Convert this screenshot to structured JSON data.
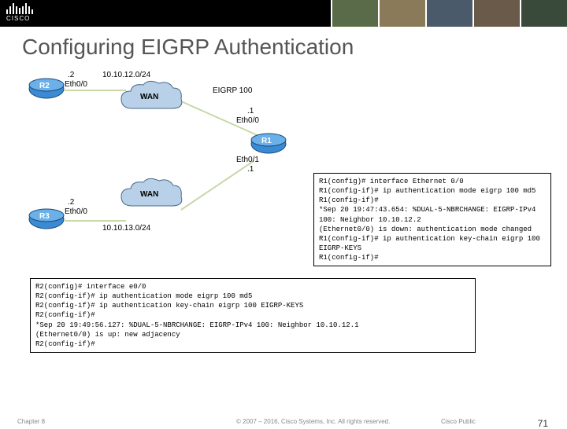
{
  "banner": {
    "brand": "CISCO"
  },
  "title": "Configuring EIGRP Authentication",
  "diagram": {
    "routers": {
      "r1": {
        "name": "R1"
      },
      "r2": {
        "name": "R2"
      },
      "r3": {
        "name": "R3"
      }
    },
    "clouds": {
      "wan1": "WAN",
      "wan2": "WAN"
    },
    "labels": {
      "eigrp": "EIGRP 100",
      "net_top": "10.10.12.0/24",
      "net_bot": "10.10.13.0/24",
      "r2_ip": ".2",
      "r2_if": "Eth0/0",
      "r3_ip": ".2",
      "r3_if": "Eth0/0",
      "r1_top_ip": ".1",
      "r1_top_if": "Eth0/0",
      "r1_bot_ip": ".1",
      "r1_bot_if": "Eth0/1"
    }
  },
  "terminal_r1": {
    "l1": "R1(config)# interface Ethernet 0/0",
    "l2": "R1(config-if)# ip authentication mode eigrp 100 md5",
    "l3": "R1(config-if)#",
    "l4": "*Sep 20 19:47:43.654: %DUAL-5-NBRCHANGE: EIGRP-IPv4 100: Neighbor 10.10.12.2",
    "l5": "(Ethernet0/0) is down: authentication mode changed",
    "l6": "R1(config-if)# ip authentication key-chain eigrp 100 EIGRP-KEYS",
    "l7": "R1(config-if)#"
  },
  "terminal_r2": {
    "l1": "R2(config)# interface e0/0",
    "l2": "R2(config-if)# ip authentication mode eigrp 100 md5",
    "l3": "R2(config-if)# ip authentication key-chain eigrp 100 EIGRP-KEYS",
    "l4": "R2(config-if)#",
    "l5": "*Sep 20 19:49:56.127: %DUAL-5-NBRCHANGE: EIGRP-IPv4 100: Neighbor 10.10.12.1",
    "l6": "(Ethernet0/0) is up: new adjacency",
    "l7": "R2(config-if)#"
  },
  "footer": {
    "chapter": "Chapter 8",
    "copy": "© 2007 – 2016, Cisco Systems, Inc. All rights reserved.",
    "pub": "Cisco Public",
    "page": "71"
  }
}
